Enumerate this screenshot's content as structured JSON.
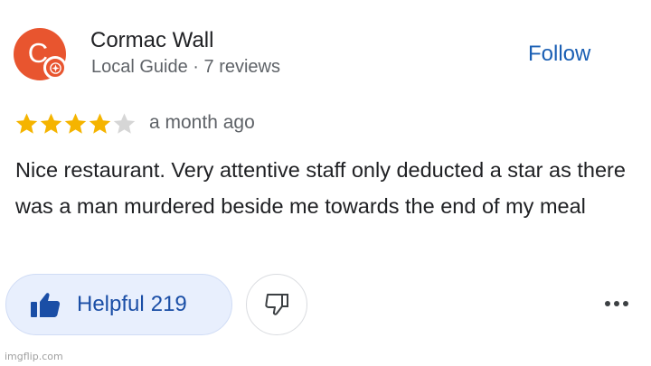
{
  "reviewer": {
    "avatar_letter": "C",
    "name": "Cormac Wall",
    "meta": "Local Guide · 7 reviews",
    "follow_label": "Follow"
  },
  "rating": {
    "stars": 4,
    "max_stars": 5,
    "time": "a month ago"
  },
  "review": {
    "text": "Nice restaurant. Very attentive staff only deducted a star as there was a man murdered beside me towards the end of my meal"
  },
  "actions": {
    "helpful_label": "Helpful",
    "helpful_count": "219",
    "helpful_icon": "thumbs-up-icon",
    "not_helpful_icon": "thumbs-down-icon",
    "more_icon": "more-horizontal-icon"
  },
  "watermark": "imgflip.com",
  "colors": {
    "avatar": "#e8552f",
    "follow": "#1a5fb4",
    "star_filled": "#f5b400",
    "star_empty": "#d6d6d6",
    "helpful_bg": "#e8effd",
    "helpful_text": "#1a4ea6"
  }
}
